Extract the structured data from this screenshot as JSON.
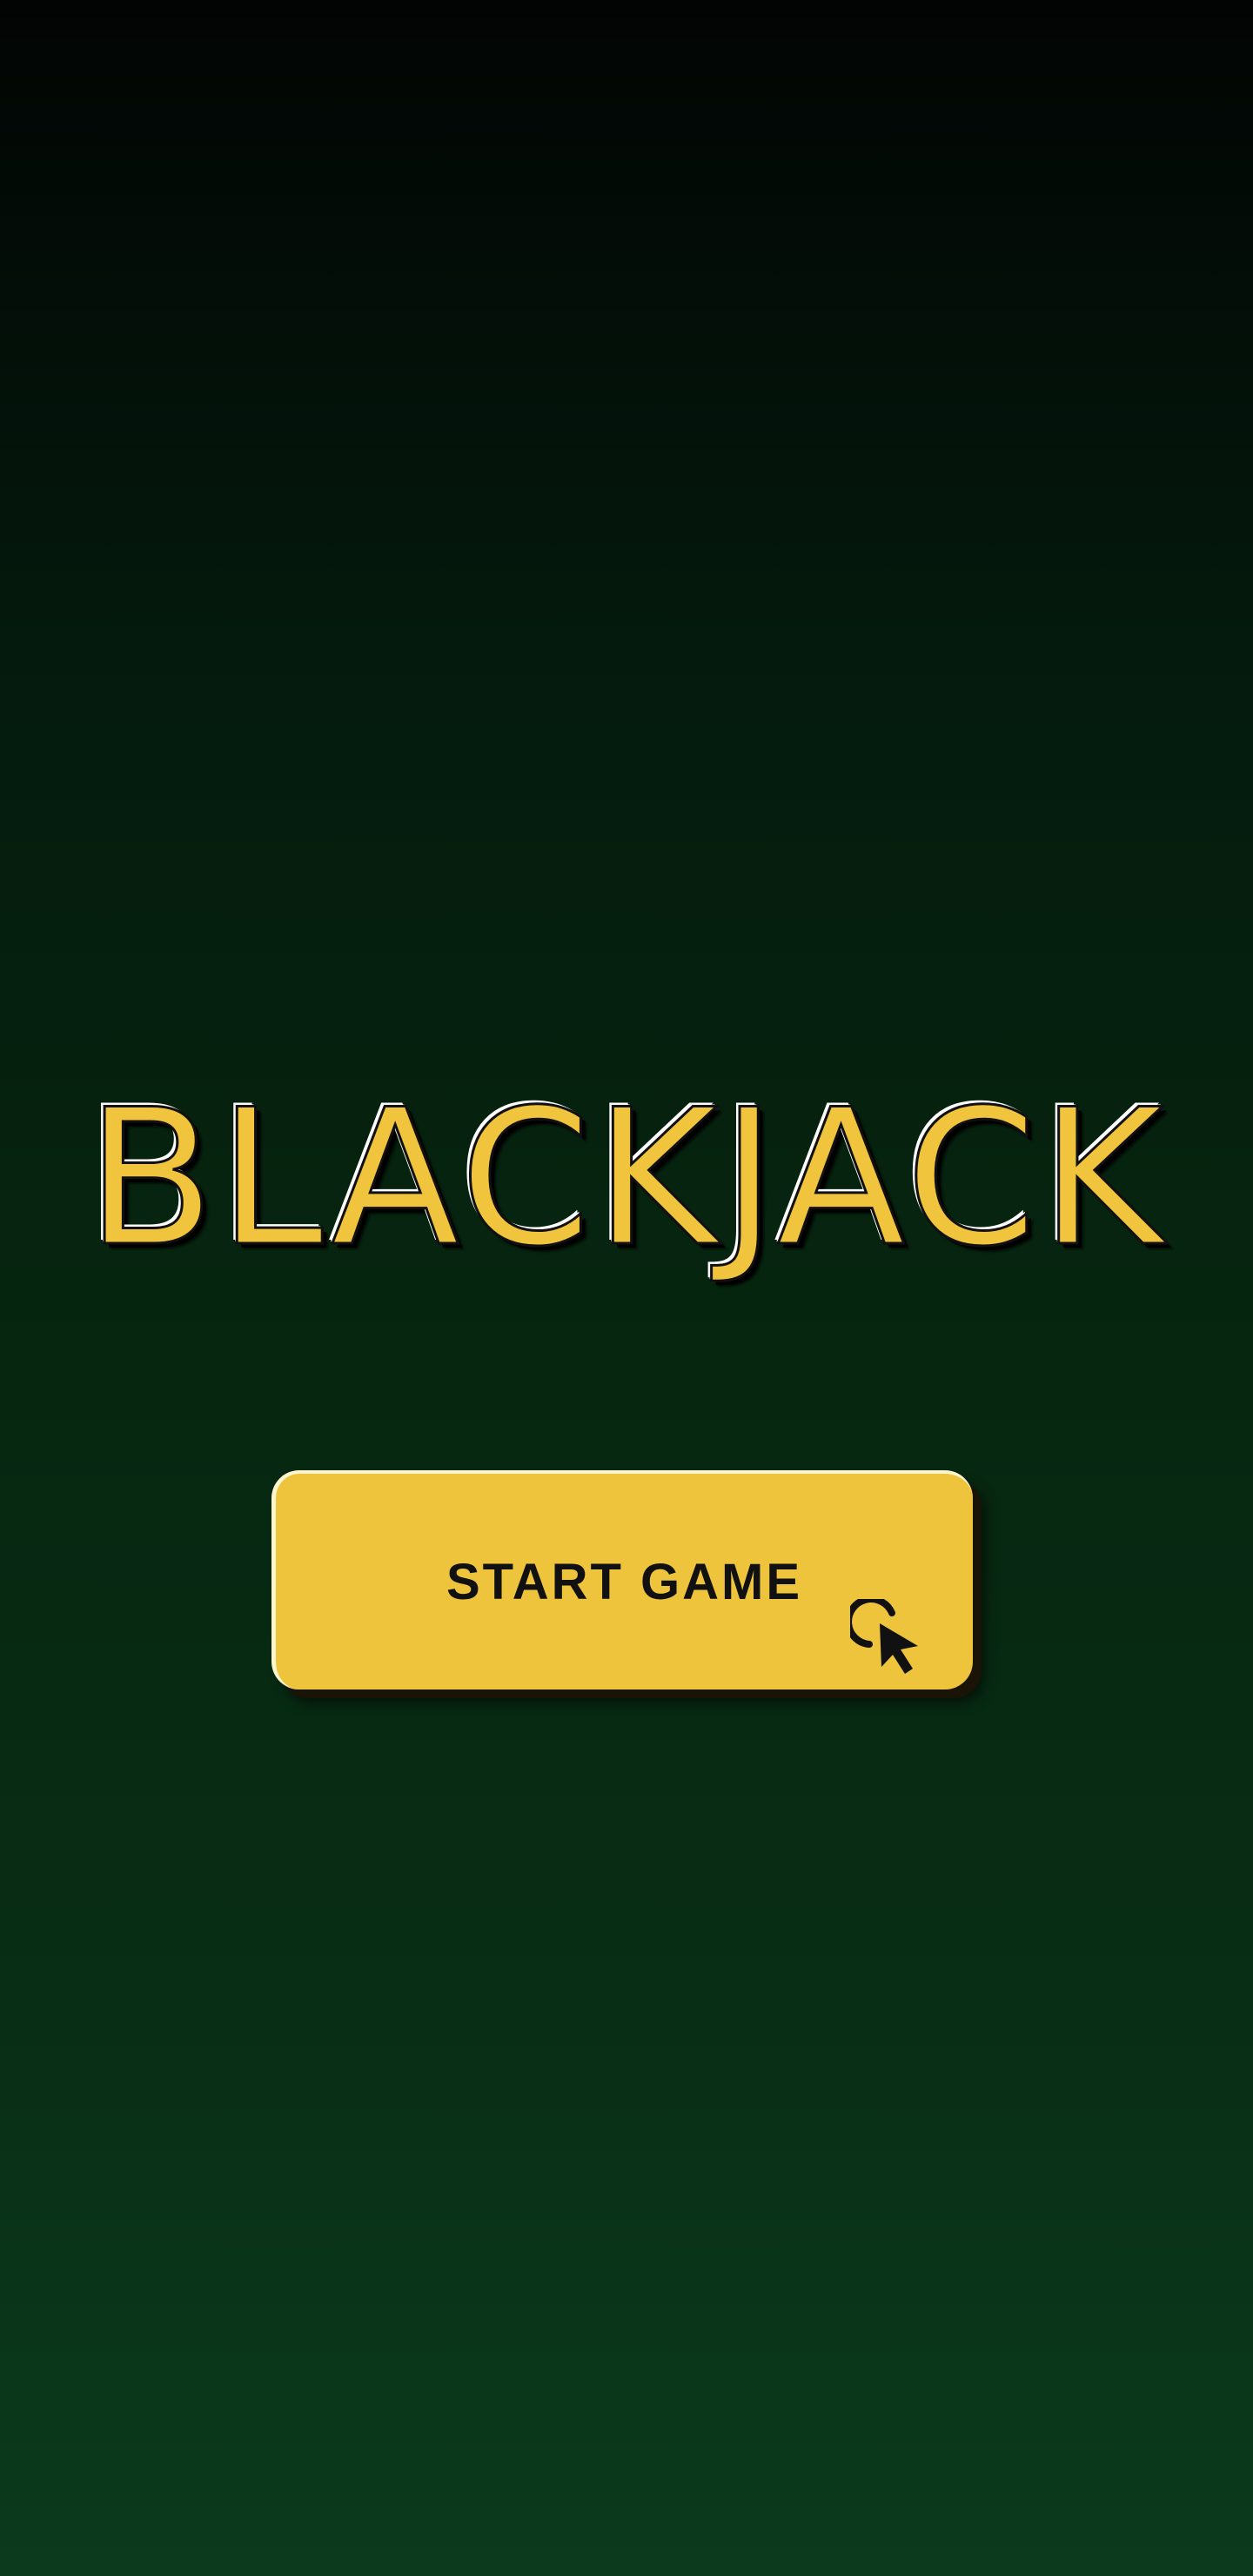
{
  "game": {
    "title": "BLACKJACK",
    "start_button_label": "START GAME",
    "start_button_icon": "click-cursor-icon"
  },
  "colors": {
    "background_top": "#020403",
    "background_bottom": "#0b3a1c",
    "title_fill": "#f1c43e",
    "button_fill": "#eec43d",
    "button_text": "#111111"
  }
}
